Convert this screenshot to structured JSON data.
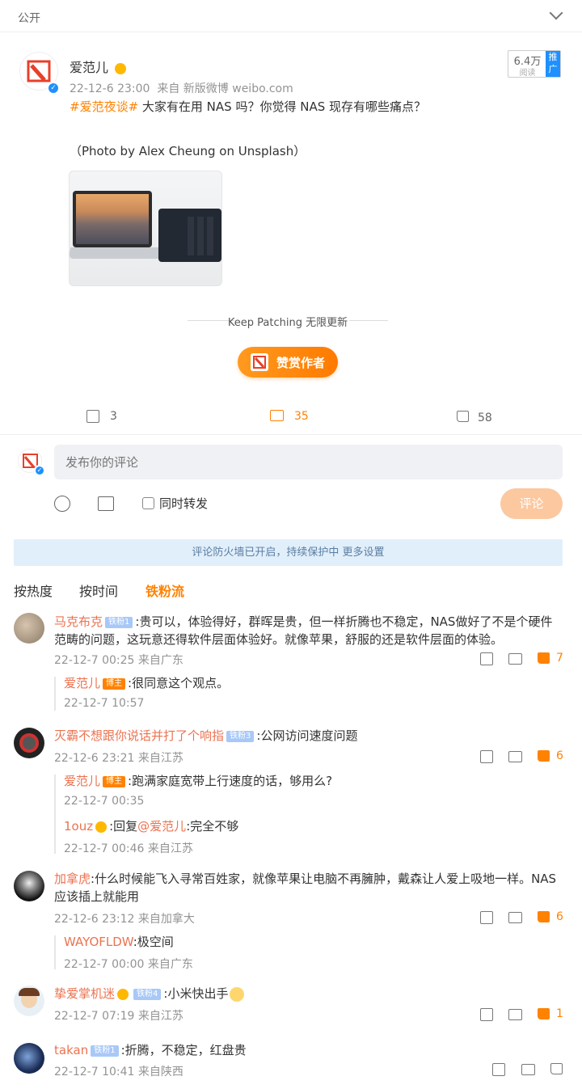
{
  "header": {
    "visibility": "公开"
  },
  "post": {
    "author": "爱范儿",
    "time": "22-12-6 23:00",
    "source": "来自 新版微博 weibo.com",
    "reads": "6.4万",
    "reads_label": "阅读",
    "promote": "推广",
    "topic": "#爱范夜谈#",
    "text": " 大家有在用 NAS 吗？你觉得 NAS 现存有哪些痛点？",
    "caption": "（Photo by Alex Cheung on Unsplash）",
    "tagline": "Keep Patching 无限更新",
    "reward": "赞赏作者",
    "shares": "3",
    "comments": "35",
    "likes": "58"
  },
  "composer": {
    "placeholder": "发布你的评论",
    "repost": "同时转发",
    "submit": "评论"
  },
  "notice": "评论防火墙已开启，持续保护中 更多设置",
  "sort_tabs": [
    "按热度",
    "按时间",
    "铁粉流"
  ],
  "comments": [
    {
      "user": "马克布克",
      "badge": "铁粉1",
      "text": ":贵可以，体验得好，群晖是贵，但一样折腾也不稳定，NAS做好了不是个硬件范畴的问题，这玩意还得软件层面体验好。就像苹果，舒服的还是软件层面的体验。",
      "meta": "22-12-7 00:25 来自广东",
      "likes": "7",
      "replies": [
        {
          "user": "爱范儿",
          "badge": "博主",
          "text": ":很同意这个观点。",
          "meta": "22-12-7 10:57"
        }
      ]
    },
    {
      "user": "灭霸不想跟你说话并打了个响指",
      "badge": "铁粉3",
      "text": ":公网访问速度问题",
      "meta": "22-12-6 23:21 来自江苏",
      "likes": "6",
      "replies": [
        {
          "user": "爱范儿",
          "badge": "博主",
          "text": ":跑满家庭宽带上行速度的话，够用么?",
          "meta": "22-12-7 00:35"
        },
        {
          "user": "1ouz",
          "badge": "",
          "text": ":回复",
          "mention": "@爱范儿",
          "text2": ":完全不够",
          "meta": "22-12-7 00:46 来自江苏"
        }
      ]
    },
    {
      "user": "加拿虎",
      "badge": "",
      "text": ":什么时候能飞入寻常百姓家，就像苹果让电脑不再臃肿，戴森让人爱上吸地一样。NAS应该插上就能用",
      "meta": "22-12-6 23:12 来自加拿大",
      "likes": "6",
      "replies": [
        {
          "user": "WAYOFLDW",
          "badge": "",
          "text": ":极空间",
          "meta": "22-12-7 00:00 来自广东"
        }
      ]
    },
    {
      "user": "挚爱掌机迷",
      "badge": "铁粉4",
      "text": ":小米快出手",
      "meta": "22-12-7 07:19 来自江苏",
      "likes": "1",
      "replies": []
    },
    {
      "user": "takan",
      "badge": "铁粉1",
      "text": ":折腾，不稳定，红盘贵",
      "meta": "22-12-7 10:41 来自陕西",
      "likes": "",
      "replies": []
    }
  ],
  "colors": {
    "accent": "#ff8200",
    "link": "#eb7350",
    "verified": "#1e90ff"
  }
}
